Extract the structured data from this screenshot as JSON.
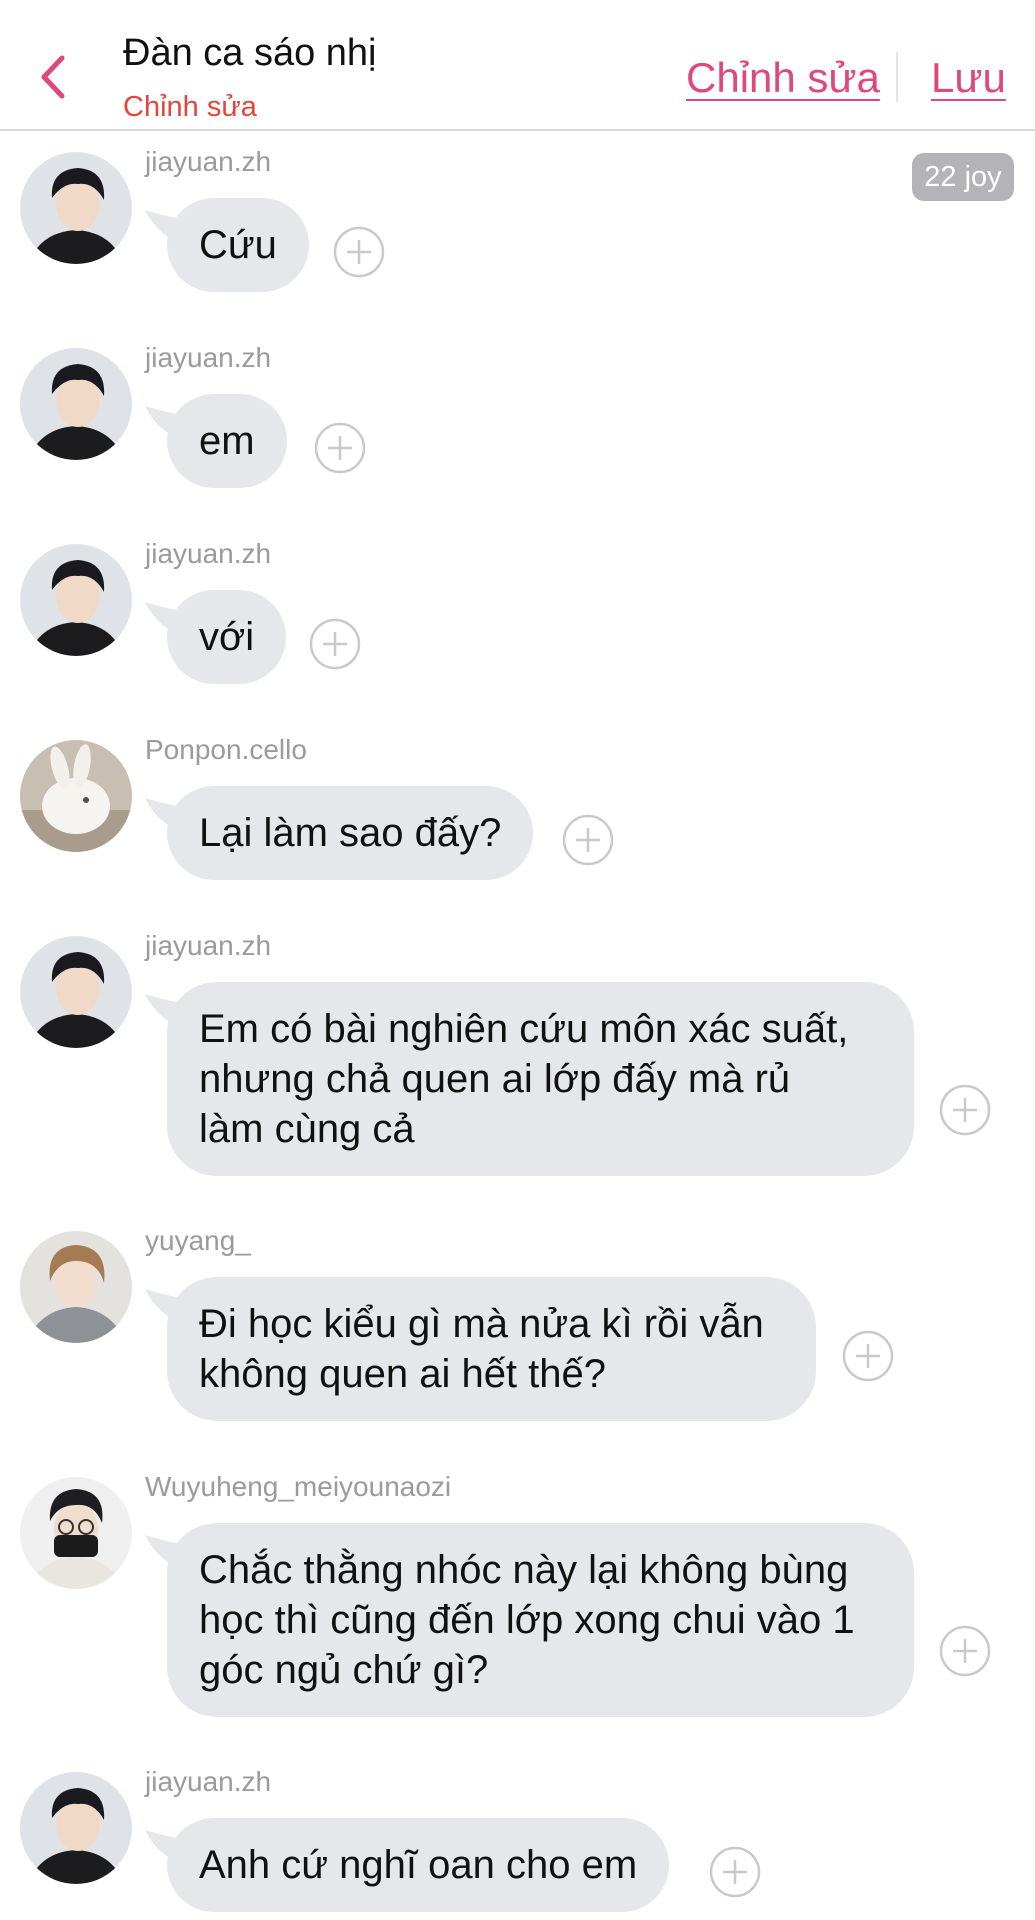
{
  "header": {
    "title": "Đàn ca sáo nhị",
    "subtitle": "Chỉnh sửa",
    "edit_label": "Chỉnh sửa",
    "save_label": "Lưu"
  },
  "timestamp_badge": "22 joy",
  "colors": {
    "accent": "#e0487a",
    "subtitle": "#e2463a",
    "bubble": "#e6e7ea",
    "sender": "#9a9a9f"
  },
  "messages": [
    {
      "sender": "jiayuan.zh",
      "text": "Cứu",
      "avatar": "jiayuan-avatar"
    },
    {
      "sender": "jiayuan.zh",
      "text": "em",
      "avatar": "jiayuan-avatar"
    },
    {
      "sender": "jiayuan.zh",
      "text": "với",
      "avatar": "jiayuan-avatar"
    },
    {
      "sender": "Ponpon.cello",
      "text": "Lại làm sao đấy?",
      "avatar": "rabbit-avatar"
    },
    {
      "sender": "jiayuan.zh",
      "text": "Em có bài nghiên cứu môn xác suất,\nnhưng chả quen ai lớp đấy mà rủ\nlàm cùng cả",
      "avatar": "jiayuan-avatar"
    },
    {
      "sender": "yuyang_",
      "text": "Đi học kiểu gì mà nửa kì rồi vẫn\nkhông quen ai hết thế?",
      "avatar": "yuyang-avatar"
    },
    {
      "sender": "Wuyuheng_meiyounaozi",
      "text": "Chắc thằng nhóc này lại không bùng\nhọc thì cũng đến lớp xong chui vào 1\ngóc ngủ chứ gì?",
      "avatar": "wuyuheng-avatar"
    },
    {
      "sender": "jiayuan.zh",
      "text": "Anh cứ nghĩ oan cho em",
      "avatar": "jiayuan-avatar"
    }
  ]
}
